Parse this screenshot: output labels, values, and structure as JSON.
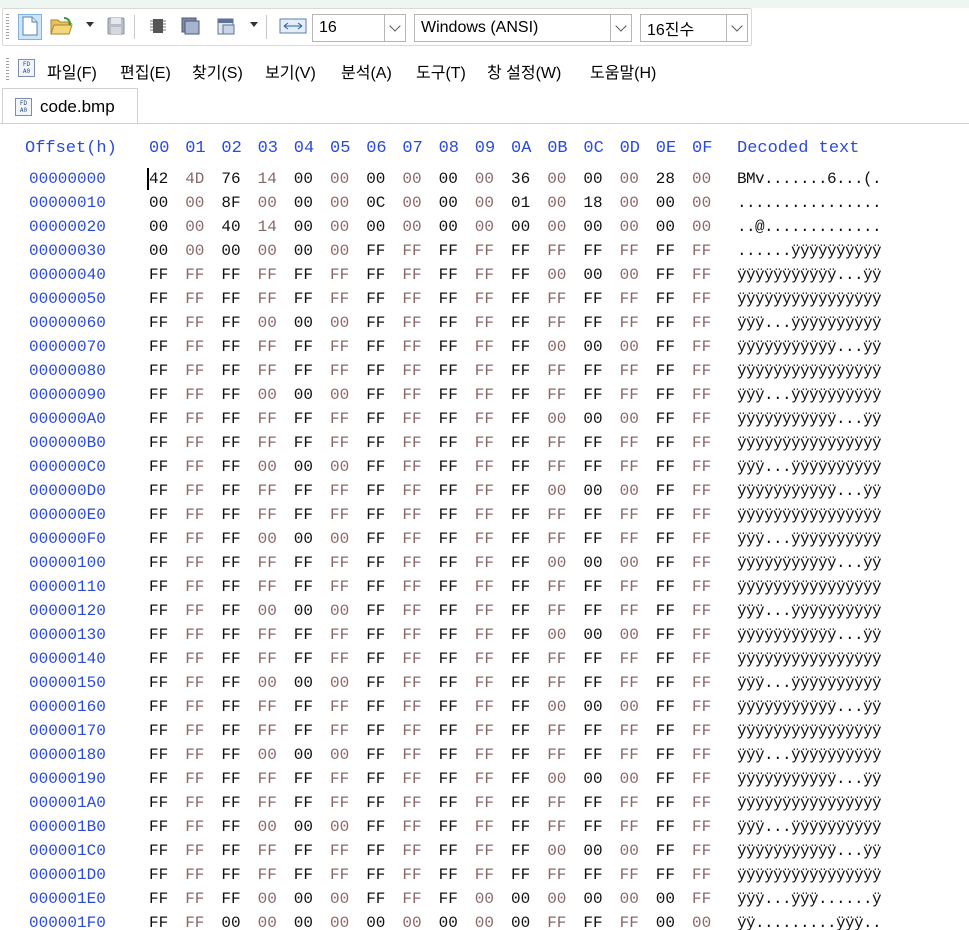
{
  "toolbar": {
    "font_size_value": "16",
    "encoding_value": "Windows (ANSI)",
    "number_base_value": "16진수"
  },
  "menu": {
    "items": [
      "파일(F)",
      "편집(E)",
      "찾기(S)",
      "보기(V)",
      "분석(A)",
      "도구(T)",
      "창 설정(W)",
      "도움말(H)"
    ]
  },
  "tab": {
    "label": "code.bmp"
  },
  "icon_text": "FD A0",
  "hex_view": {
    "offset_header": "Offset(h)",
    "column_headers": [
      "00",
      "01",
      "02",
      "03",
      "04",
      "05",
      "06",
      "07",
      "08",
      "09",
      "0A",
      "0B",
      "0C",
      "0D",
      "0E",
      "0F"
    ],
    "decoded_header": "Decoded text",
    "rows": [
      {
        "offset": "00000000",
        "bytes": [
          "42",
          "4D",
          "76",
          "14",
          "00",
          "00",
          "00",
          "00",
          "00",
          "00",
          "36",
          "00",
          "00",
          "00",
          "28",
          "00"
        ],
        "text": "BMv.......6...(."
      },
      {
        "offset": "00000010",
        "bytes": [
          "00",
          "00",
          "8F",
          "00",
          "00",
          "00",
          "0C",
          "00",
          "00",
          "00",
          "01",
          "00",
          "18",
          "00",
          "00",
          "00"
        ],
        "text": "................"
      },
      {
        "offset": "00000020",
        "bytes": [
          "00",
          "00",
          "40",
          "14",
          "00",
          "00",
          "00",
          "00",
          "00",
          "00",
          "00",
          "00",
          "00",
          "00",
          "00",
          "00"
        ],
        "text": "..@............."
      },
      {
        "offset": "00000030",
        "bytes": [
          "00",
          "00",
          "00",
          "00",
          "00",
          "00",
          "FF",
          "FF",
          "FF",
          "FF",
          "FF",
          "FF",
          "FF",
          "FF",
          "FF",
          "FF"
        ],
        "text": "......ÿÿÿÿÿÿÿÿÿÿ"
      },
      {
        "offset": "00000040",
        "bytes": [
          "FF",
          "FF",
          "FF",
          "FF",
          "FF",
          "FF",
          "FF",
          "FF",
          "FF",
          "FF",
          "FF",
          "00",
          "00",
          "00",
          "FF",
          "FF"
        ],
        "text": "ÿÿÿÿÿÿÿÿÿÿÿ...ÿÿ"
      },
      {
        "offset": "00000050",
        "bytes": [
          "FF",
          "FF",
          "FF",
          "FF",
          "FF",
          "FF",
          "FF",
          "FF",
          "FF",
          "FF",
          "FF",
          "FF",
          "FF",
          "FF",
          "FF",
          "FF"
        ],
        "text": "ÿÿÿÿÿÿÿÿÿÿÿÿÿÿÿÿ"
      },
      {
        "offset": "00000060",
        "bytes": [
          "FF",
          "FF",
          "FF",
          "00",
          "00",
          "00",
          "FF",
          "FF",
          "FF",
          "FF",
          "FF",
          "FF",
          "FF",
          "FF",
          "FF",
          "FF"
        ],
        "text": "ÿÿÿ...ÿÿÿÿÿÿÿÿÿÿ"
      },
      {
        "offset": "00000070",
        "bytes": [
          "FF",
          "FF",
          "FF",
          "FF",
          "FF",
          "FF",
          "FF",
          "FF",
          "FF",
          "FF",
          "FF",
          "00",
          "00",
          "00",
          "FF",
          "FF"
        ],
        "text": "ÿÿÿÿÿÿÿÿÿÿÿ...ÿÿ"
      },
      {
        "offset": "00000080",
        "bytes": [
          "FF",
          "FF",
          "FF",
          "FF",
          "FF",
          "FF",
          "FF",
          "FF",
          "FF",
          "FF",
          "FF",
          "FF",
          "FF",
          "FF",
          "FF",
          "FF"
        ],
        "text": "ÿÿÿÿÿÿÿÿÿÿÿÿÿÿÿÿ"
      },
      {
        "offset": "00000090",
        "bytes": [
          "FF",
          "FF",
          "FF",
          "00",
          "00",
          "00",
          "FF",
          "FF",
          "FF",
          "FF",
          "FF",
          "FF",
          "FF",
          "FF",
          "FF",
          "FF"
        ],
        "text": "ÿÿÿ...ÿÿÿÿÿÿÿÿÿÿ"
      },
      {
        "offset": "000000A0",
        "bytes": [
          "FF",
          "FF",
          "FF",
          "FF",
          "FF",
          "FF",
          "FF",
          "FF",
          "FF",
          "FF",
          "FF",
          "00",
          "00",
          "00",
          "FF",
          "FF"
        ],
        "text": "ÿÿÿÿÿÿÿÿÿÿÿ...ÿÿ"
      },
      {
        "offset": "000000B0",
        "bytes": [
          "FF",
          "FF",
          "FF",
          "FF",
          "FF",
          "FF",
          "FF",
          "FF",
          "FF",
          "FF",
          "FF",
          "FF",
          "FF",
          "FF",
          "FF",
          "FF"
        ],
        "text": "ÿÿÿÿÿÿÿÿÿÿÿÿÿÿÿÿ"
      },
      {
        "offset": "000000C0",
        "bytes": [
          "FF",
          "FF",
          "FF",
          "00",
          "00",
          "00",
          "FF",
          "FF",
          "FF",
          "FF",
          "FF",
          "FF",
          "FF",
          "FF",
          "FF",
          "FF"
        ],
        "text": "ÿÿÿ...ÿÿÿÿÿÿÿÿÿÿ"
      },
      {
        "offset": "000000D0",
        "bytes": [
          "FF",
          "FF",
          "FF",
          "FF",
          "FF",
          "FF",
          "FF",
          "FF",
          "FF",
          "FF",
          "FF",
          "00",
          "00",
          "00",
          "FF",
          "FF"
        ],
        "text": "ÿÿÿÿÿÿÿÿÿÿÿ...ÿÿ"
      },
      {
        "offset": "000000E0",
        "bytes": [
          "FF",
          "FF",
          "FF",
          "FF",
          "FF",
          "FF",
          "FF",
          "FF",
          "FF",
          "FF",
          "FF",
          "FF",
          "FF",
          "FF",
          "FF",
          "FF"
        ],
        "text": "ÿÿÿÿÿÿÿÿÿÿÿÿÿÿÿÿ"
      },
      {
        "offset": "000000F0",
        "bytes": [
          "FF",
          "FF",
          "FF",
          "00",
          "00",
          "00",
          "FF",
          "FF",
          "FF",
          "FF",
          "FF",
          "FF",
          "FF",
          "FF",
          "FF",
          "FF"
        ],
        "text": "ÿÿÿ...ÿÿÿÿÿÿÿÿÿÿ"
      },
      {
        "offset": "00000100",
        "bytes": [
          "FF",
          "FF",
          "FF",
          "FF",
          "FF",
          "FF",
          "FF",
          "FF",
          "FF",
          "FF",
          "FF",
          "00",
          "00",
          "00",
          "FF",
          "FF"
        ],
        "text": "ÿÿÿÿÿÿÿÿÿÿÿ...ÿÿ"
      },
      {
        "offset": "00000110",
        "bytes": [
          "FF",
          "FF",
          "FF",
          "FF",
          "FF",
          "FF",
          "FF",
          "FF",
          "FF",
          "FF",
          "FF",
          "FF",
          "FF",
          "FF",
          "FF",
          "FF"
        ],
        "text": "ÿÿÿÿÿÿÿÿÿÿÿÿÿÿÿÿ"
      },
      {
        "offset": "00000120",
        "bytes": [
          "FF",
          "FF",
          "FF",
          "00",
          "00",
          "00",
          "FF",
          "FF",
          "FF",
          "FF",
          "FF",
          "FF",
          "FF",
          "FF",
          "FF",
          "FF"
        ],
        "text": "ÿÿÿ...ÿÿÿÿÿÿÿÿÿÿ"
      },
      {
        "offset": "00000130",
        "bytes": [
          "FF",
          "FF",
          "FF",
          "FF",
          "FF",
          "FF",
          "FF",
          "FF",
          "FF",
          "FF",
          "FF",
          "00",
          "00",
          "00",
          "FF",
          "FF"
        ],
        "text": "ÿÿÿÿÿÿÿÿÿÿÿ...ÿÿ"
      },
      {
        "offset": "00000140",
        "bytes": [
          "FF",
          "FF",
          "FF",
          "FF",
          "FF",
          "FF",
          "FF",
          "FF",
          "FF",
          "FF",
          "FF",
          "FF",
          "FF",
          "FF",
          "FF",
          "FF"
        ],
        "text": "ÿÿÿÿÿÿÿÿÿÿÿÿÿÿÿÿ"
      },
      {
        "offset": "00000150",
        "bytes": [
          "FF",
          "FF",
          "FF",
          "00",
          "00",
          "00",
          "FF",
          "FF",
          "FF",
          "FF",
          "FF",
          "FF",
          "FF",
          "FF",
          "FF",
          "FF"
        ],
        "text": "ÿÿÿ...ÿÿÿÿÿÿÿÿÿÿ"
      },
      {
        "offset": "00000160",
        "bytes": [
          "FF",
          "FF",
          "FF",
          "FF",
          "FF",
          "FF",
          "FF",
          "FF",
          "FF",
          "FF",
          "FF",
          "00",
          "00",
          "00",
          "FF",
          "FF"
        ],
        "text": "ÿÿÿÿÿÿÿÿÿÿÿ...ÿÿ"
      },
      {
        "offset": "00000170",
        "bytes": [
          "FF",
          "FF",
          "FF",
          "FF",
          "FF",
          "FF",
          "FF",
          "FF",
          "FF",
          "FF",
          "FF",
          "FF",
          "FF",
          "FF",
          "FF",
          "FF"
        ],
        "text": "ÿÿÿÿÿÿÿÿÿÿÿÿÿÿÿÿ"
      },
      {
        "offset": "00000180",
        "bytes": [
          "FF",
          "FF",
          "FF",
          "00",
          "00",
          "00",
          "FF",
          "FF",
          "FF",
          "FF",
          "FF",
          "FF",
          "FF",
          "FF",
          "FF",
          "FF"
        ],
        "text": "ÿÿÿ...ÿÿÿÿÿÿÿÿÿÿ"
      },
      {
        "offset": "00000190",
        "bytes": [
          "FF",
          "FF",
          "FF",
          "FF",
          "FF",
          "FF",
          "FF",
          "FF",
          "FF",
          "FF",
          "FF",
          "00",
          "00",
          "00",
          "FF",
          "FF"
        ],
        "text": "ÿÿÿÿÿÿÿÿÿÿÿ...ÿÿ"
      },
      {
        "offset": "000001A0",
        "bytes": [
          "FF",
          "FF",
          "FF",
          "FF",
          "FF",
          "FF",
          "FF",
          "FF",
          "FF",
          "FF",
          "FF",
          "FF",
          "FF",
          "FF",
          "FF",
          "FF"
        ],
        "text": "ÿÿÿÿÿÿÿÿÿÿÿÿÿÿÿÿ"
      },
      {
        "offset": "000001B0",
        "bytes": [
          "FF",
          "FF",
          "FF",
          "00",
          "00",
          "00",
          "FF",
          "FF",
          "FF",
          "FF",
          "FF",
          "FF",
          "FF",
          "FF",
          "FF",
          "FF"
        ],
        "text": "ÿÿÿ...ÿÿÿÿÿÿÿÿÿÿ"
      },
      {
        "offset": "000001C0",
        "bytes": [
          "FF",
          "FF",
          "FF",
          "FF",
          "FF",
          "FF",
          "FF",
          "FF",
          "FF",
          "FF",
          "FF",
          "00",
          "00",
          "00",
          "FF",
          "FF"
        ],
        "text": "ÿÿÿÿÿÿÿÿÿÿÿ...ÿÿ"
      },
      {
        "offset": "000001D0",
        "bytes": [
          "FF",
          "FF",
          "FF",
          "FF",
          "FF",
          "FF",
          "FF",
          "FF",
          "FF",
          "FF",
          "FF",
          "FF",
          "FF",
          "FF",
          "FF",
          "FF"
        ],
        "text": "ÿÿÿÿÿÿÿÿÿÿÿÿÿÿÿÿ"
      },
      {
        "offset": "000001E0",
        "bytes": [
          "FF",
          "FF",
          "FF",
          "00",
          "00",
          "00",
          "FF",
          "FF",
          "FF",
          "00",
          "00",
          "00",
          "00",
          "00",
          "00",
          "FF"
        ],
        "text": "ÿÿÿ...ÿÿÿ......ÿ"
      },
      {
        "offset": "000001F0",
        "bytes": [
          "FF",
          "FF",
          "00",
          "00",
          "00",
          "00",
          "00",
          "00",
          "00",
          "00",
          "00",
          "FF",
          "FF",
          "FF",
          "00",
          "00"
        ],
        "text": "ÿÿ.........ÿÿÿ.."
      }
    ]
  }
}
